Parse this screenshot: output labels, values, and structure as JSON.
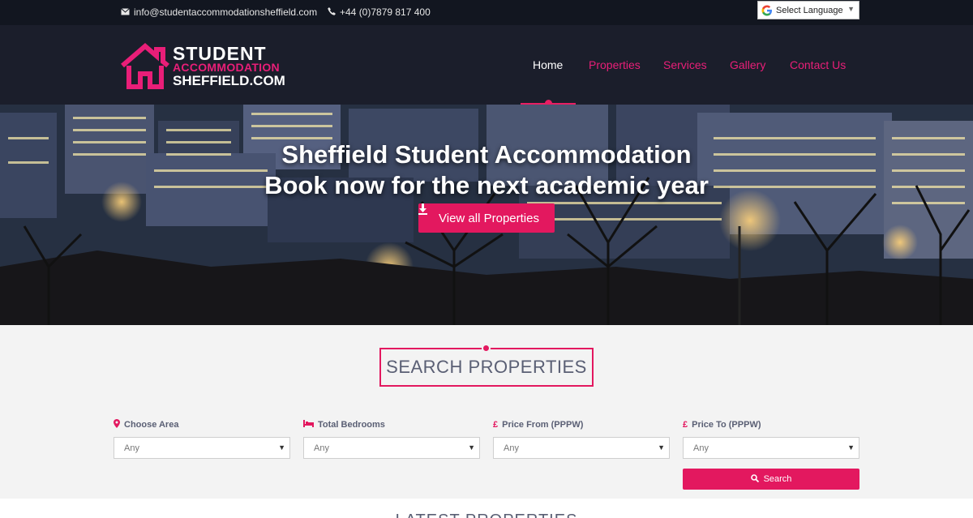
{
  "topbar": {
    "email": "info@studentaccommodationsheffield.com",
    "phone": "+44 (0)7879 817 400",
    "language": "Select Language"
  },
  "logo": {
    "line1": "STUDENT",
    "line2": "ACCOMMODATION",
    "line3": "SHEFFIELD.COM"
  },
  "nav": {
    "items": [
      "Home",
      "Properties",
      "Services",
      "Gallery",
      "Contact Us"
    ],
    "active": "Home"
  },
  "hero": {
    "title_line1": "Sheffield Student Accommodation",
    "title_line2": "Book now for the next academic year",
    "button": "View all Properties"
  },
  "search": {
    "title": "SEARCH PROPERTIES",
    "fields": [
      {
        "label": "Choose Area",
        "value": "Any",
        "icon": "map-marker-icon"
      },
      {
        "label": "Total Bedrooms",
        "value": "Any",
        "icon": "bed-icon"
      },
      {
        "label": "Price From (PPPW)",
        "value": "Any",
        "icon": "pound-icon"
      },
      {
        "label": "Price To (PPPW)",
        "value": "Any",
        "icon": "pound-icon"
      }
    ],
    "button": "Search"
  },
  "latest": {
    "title": "LATEST PROPERTIES"
  },
  "colors": {
    "accent": "#e3185f",
    "topbar": "#121620",
    "header": "#1b1e2b"
  }
}
